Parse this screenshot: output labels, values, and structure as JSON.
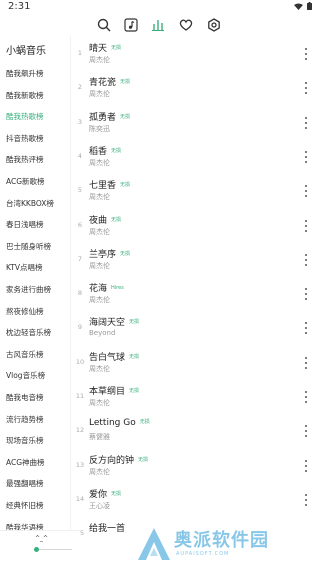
{
  "statusbar": {
    "time": "2:31"
  },
  "nav": {
    "items": [
      {
        "icon": "search-icon"
      },
      {
        "icon": "music-note-icon"
      },
      {
        "icon": "chart-bars-icon",
        "active": true
      },
      {
        "icon": "heart-icon"
      },
      {
        "icon": "gear-icon"
      }
    ]
  },
  "sidebar": {
    "app_title": "小蜗音乐",
    "categories": [
      "酷我飙升榜",
      "酷我新歌榜",
      "酷我热歌榜",
      "抖音热歌榜",
      "酷我热评榜",
      "ACG新歌榜",
      "台湾KKBOX榜",
      "春日浅唱榜",
      "巴士随身听榜",
      "KTV点唱榜",
      "家务进行曲榜",
      "熬夜修仙榜",
      "枕边轻音乐榜",
      "古风音乐榜",
      "Vlog音乐榜",
      "酷我电音榜",
      "流行趋势榜",
      "现场音乐榜",
      "ACG神曲榜",
      "最强翻唱榜",
      "经典怀旧榜",
      "酷我华语榜"
    ],
    "active_index": 2
  },
  "songs": [
    {
      "num": "1",
      "title": "晴天",
      "tag": "无损",
      "artist": "周杰伦"
    },
    {
      "num": "2",
      "title": "青花瓷",
      "tag": "无损",
      "artist": "周杰伦"
    },
    {
      "num": "3",
      "title": "孤勇者",
      "tag": "无损",
      "artist": "陈奕迅"
    },
    {
      "num": "4",
      "title": "稻香",
      "tag": "无损",
      "artist": "周杰伦"
    },
    {
      "num": "5",
      "title": "七里香",
      "tag": "无损",
      "artist": "周杰伦"
    },
    {
      "num": "6",
      "title": "夜曲",
      "tag": "无损",
      "artist": "周杰伦"
    },
    {
      "num": "7",
      "title": "兰亭序",
      "tag": "无损",
      "artist": "周杰伦"
    },
    {
      "num": "8",
      "title": "花海",
      "tag": "Hires",
      "artist": "周杰伦"
    },
    {
      "num": "9",
      "title": "海阔天空",
      "tag": "无损",
      "artist": "Beyond"
    },
    {
      "num": "10",
      "title": "告白气球",
      "tag": "无损",
      "artist": "周杰伦"
    },
    {
      "num": "11",
      "title": "本草纲目",
      "tag": "无损",
      "artist": "周杰伦"
    },
    {
      "num": "12",
      "title": "Letting Go",
      "tag": "无损",
      "artist": "蔡健雅"
    },
    {
      "num": "13",
      "title": "反方向的钟",
      "tag": "无损",
      "artist": "周杰伦"
    },
    {
      "num": "14",
      "title": "爱你",
      "tag": "无损",
      "artist": "王心凌"
    },
    {
      "num": "15",
      "title": "给我一首",
      "tag": "",
      "artist": ""
    }
  ],
  "player": {
    "face": "^_^",
    "progress": 0.0
  },
  "watermark": {
    "text": "奥派软件园",
    "sub": "AUPAISOFT.COM"
  }
}
